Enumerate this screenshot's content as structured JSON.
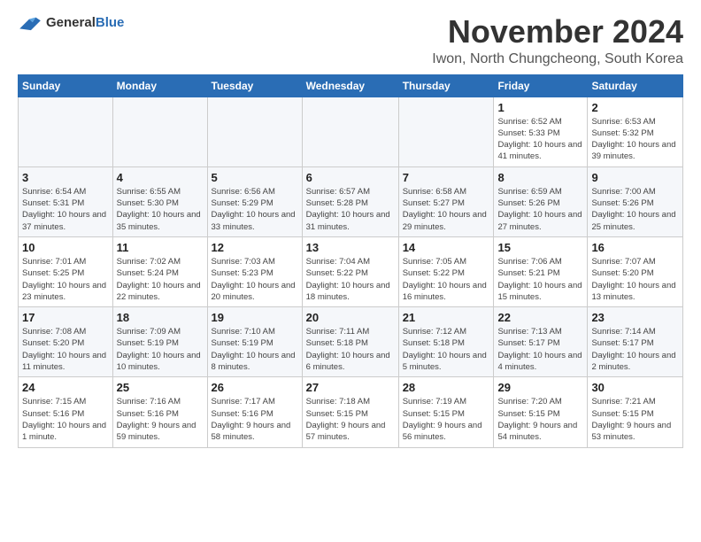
{
  "header": {
    "logo_general": "General",
    "logo_blue": "Blue",
    "month_title": "November 2024",
    "location": "Iwon, North Chungcheong, South Korea"
  },
  "weekdays": [
    "Sunday",
    "Monday",
    "Tuesday",
    "Wednesday",
    "Thursday",
    "Friday",
    "Saturday"
  ],
  "weeks": [
    {
      "row_index": 0,
      "days": [
        {
          "date": "",
          "info": ""
        },
        {
          "date": "",
          "info": ""
        },
        {
          "date": "",
          "info": ""
        },
        {
          "date": "",
          "info": ""
        },
        {
          "date": "",
          "info": ""
        },
        {
          "date": "1",
          "info": "Sunrise: 6:52 AM\nSunset: 5:33 PM\nDaylight: 10 hours and 41 minutes."
        },
        {
          "date": "2",
          "info": "Sunrise: 6:53 AM\nSunset: 5:32 PM\nDaylight: 10 hours and 39 minutes."
        }
      ]
    },
    {
      "row_index": 1,
      "days": [
        {
          "date": "3",
          "info": "Sunrise: 6:54 AM\nSunset: 5:31 PM\nDaylight: 10 hours and 37 minutes."
        },
        {
          "date": "4",
          "info": "Sunrise: 6:55 AM\nSunset: 5:30 PM\nDaylight: 10 hours and 35 minutes."
        },
        {
          "date": "5",
          "info": "Sunrise: 6:56 AM\nSunset: 5:29 PM\nDaylight: 10 hours and 33 minutes."
        },
        {
          "date": "6",
          "info": "Sunrise: 6:57 AM\nSunset: 5:28 PM\nDaylight: 10 hours and 31 minutes."
        },
        {
          "date": "7",
          "info": "Sunrise: 6:58 AM\nSunset: 5:27 PM\nDaylight: 10 hours and 29 minutes."
        },
        {
          "date": "8",
          "info": "Sunrise: 6:59 AM\nSunset: 5:26 PM\nDaylight: 10 hours and 27 minutes."
        },
        {
          "date": "9",
          "info": "Sunrise: 7:00 AM\nSunset: 5:26 PM\nDaylight: 10 hours and 25 minutes."
        }
      ]
    },
    {
      "row_index": 2,
      "days": [
        {
          "date": "10",
          "info": "Sunrise: 7:01 AM\nSunset: 5:25 PM\nDaylight: 10 hours and 23 minutes."
        },
        {
          "date": "11",
          "info": "Sunrise: 7:02 AM\nSunset: 5:24 PM\nDaylight: 10 hours and 22 minutes."
        },
        {
          "date": "12",
          "info": "Sunrise: 7:03 AM\nSunset: 5:23 PM\nDaylight: 10 hours and 20 minutes."
        },
        {
          "date": "13",
          "info": "Sunrise: 7:04 AM\nSunset: 5:22 PM\nDaylight: 10 hours and 18 minutes."
        },
        {
          "date": "14",
          "info": "Sunrise: 7:05 AM\nSunset: 5:22 PM\nDaylight: 10 hours and 16 minutes."
        },
        {
          "date": "15",
          "info": "Sunrise: 7:06 AM\nSunset: 5:21 PM\nDaylight: 10 hours and 15 minutes."
        },
        {
          "date": "16",
          "info": "Sunrise: 7:07 AM\nSunset: 5:20 PM\nDaylight: 10 hours and 13 minutes."
        }
      ]
    },
    {
      "row_index": 3,
      "days": [
        {
          "date": "17",
          "info": "Sunrise: 7:08 AM\nSunset: 5:20 PM\nDaylight: 10 hours and 11 minutes."
        },
        {
          "date": "18",
          "info": "Sunrise: 7:09 AM\nSunset: 5:19 PM\nDaylight: 10 hours and 10 minutes."
        },
        {
          "date": "19",
          "info": "Sunrise: 7:10 AM\nSunset: 5:19 PM\nDaylight: 10 hours and 8 minutes."
        },
        {
          "date": "20",
          "info": "Sunrise: 7:11 AM\nSunset: 5:18 PM\nDaylight: 10 hours and 6 minutes."
        },
        {
          "date": "21",
          "info": "Sunrise: 7:12 AM\nSunset: 5:18 PM\nDaylight: 10 hours and 5 minutes."
        },
        {
          "date": "22",
          "info": "Sunrise: 7:13 AM\nSunset: 5:17 PM\nDaylight: 10 hours and 4 minutes."
        },
        {
          "date": "23",
          "info": "Sunrise: 7:14 AM\nSunset: 5:17 PM\nDaylight: 10 hours and 2 minutes."
        }
      ]
    },
    {
      "row_index": 4,
      "days": [
        {
          "date": "24",
          "info": "Sunrise: 7:15 AM\nSunset: 5:16 PM\nDaylight: 10 hours and 1 minute."
        },
        {
          "date": "25",
          "info": "Sunrise: 7:16 AM\nSunset: 5:16 PM\nDaylight: 9 hours and 59 minutes."
        },
        {
          "date": "26",
          "info": "Sunrise: 7:17 AM\nSunset: 5:16 PM\nDaylight: 9 hours and 58 minutes."
        },
        {
          "date": "27",
          "info": "Sunrise: 7:18 AM\nSunset: 5:15 PM\nDaylight: 9 hours and 57 minutes."
        },
        {
          "date": "28",
          "info": "Sunrise: 7:19 AM\nSunset: 5:15 PM\nDaylight: 9 hours and 56 minutes."
        },
        {
          "date": "29",
          "info": "Sunrise: 7:20 AM\nSunset: 5:15 PM\nDaylight: 9 hours and 54 minutes."
        },
        {
          "date": "30",
          "info": "Sunrise: 7:21 AM\nSunset: 5:15 PM\nDaylight: 9 hours and 53 minutes."
        }
      ]
    }
  ]
}
